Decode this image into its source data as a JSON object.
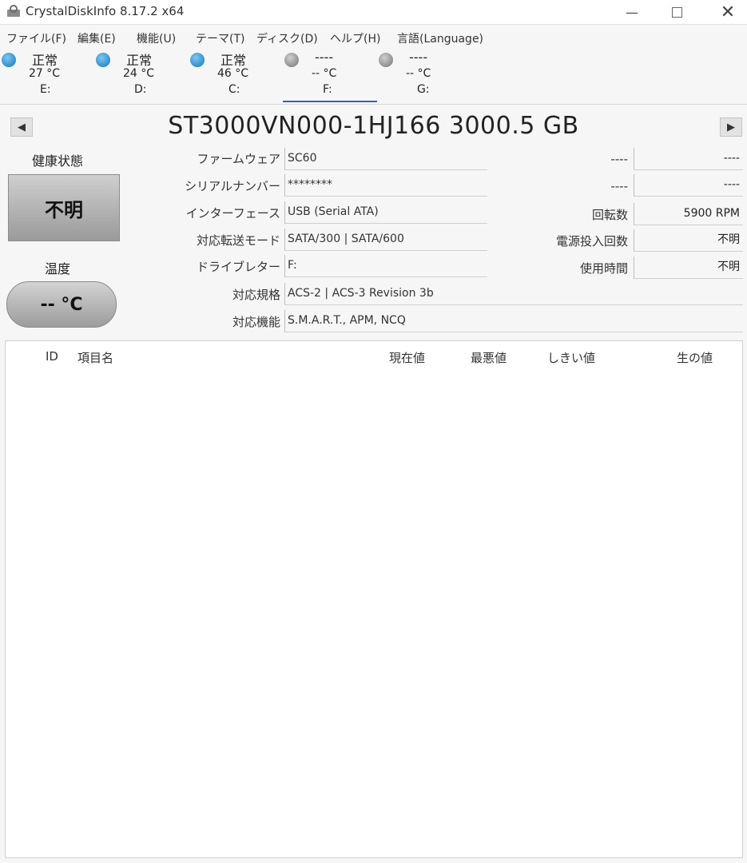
{
  "window": {
    "title": "CrystalDiskInfo 8.17.2 x64",
    "min_icon": "minimize-icon",
    "max_icon": "maximize-icon",
    "close_icon": "close-icon"
  },
  "menu": [
    {
      "label": "ファイル(F)"
    },
    {
      "label": "編集(E)"
    },
    {
      "label": "機能(U)"
    },
    {
      "label": "テーマ(T)"
    },
    {
      "label": "ディスク(D)"
    },
    {
      "label": "ヘルプ(H)"
    },
    {
      "label": "言語(Language)"
    }
  ],
  "disks": [
    {
      "status": "正常",
      "temp": "27 °C",
      "drive": "E:",
      "color": "#2c8fd0"
    },
    {
      "status": "正常",
      "temp": "24 °C",
      "drive": "D:",
      "color": "#2c8fd0"
    },
    {
      "status": "正常",
      "temp": "46 °C",
      "drive": "C:",
      "color": "#2c8fd0"
    },
    {
      "status": "----",
      "temp": "-- °C",
      "drive": "F:",
      "color": "#8f8f8f"
    },
    {
      "status": "----",
      "temp": "-- °C",
      "drive": "G:",
      "color": "#8f8f8f"
    }
  ],
  "model": "ST3000VN000-1HJ166 3000.5 GB",
  "health": {
    "label": "健康状態",
    "value": "不明"
  },
  "temperature": {
    "label": "温度",
    "value": "-- °C"
  },
  "fields": {
    "firmware": {
      "label": "ファームウェア",
      "value": "SC60"
    },
    "serial": {
      "label": "シリアルナンバー",
      "value": "********"
    },
    "interface": {
      "label": "インターフェース",
      "value": "USB (Serial ATA)"
    },
    "transfer": {
      "label": "対応転送モード",
      "value": "SATA/300 | SATA/600"
    },
    "drive_letter": {
      "label": "ドライブレター",
      "value": "F:"
    },
    "standard": {
      "label": "対応規格",
      "value": "ACS-2 | ACS-3 Revision 3b"
    },
    "features": {
      "label": "対応機能",
      "value": "S.M.A.R.T., APM, NCQ"
    }
  },
  "right_fields": {
    "r1": {
      "label": "----",
      "value": "----"
    },
    "r2": {
      "label": "----",
      "value": "----"
    },
    "rotation": {
      "label": "回転数",
      "value": "5900 RPM"
    },
    "power_count": {
      "label": "電源投入回数",
      "value": "不明"
    },
    "power_hours": {
      "label": "使用時間",
      "value": "不明"
    }
  },
  "smart_headers": {
    "id": "ID",
    "name": "項目名",
    "current": "現在値",
    "worst": "最悪値",
    "threshold": "しきい値",
    "raw": "生の値"
  },
  "colors": {
    "tab_underline": "#3b5bbf"
  }
}
